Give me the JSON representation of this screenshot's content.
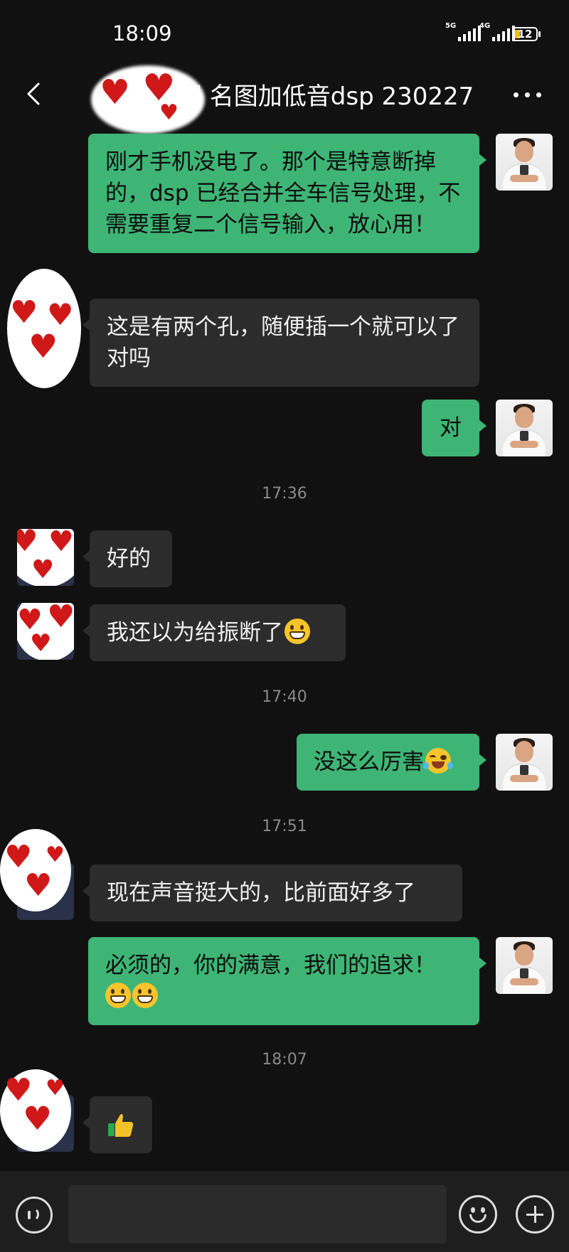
{
  "status_bar": {
    "time": "18:09",
    "signal1_label": "5G",
    "signal2_label": "4G",
    "battery": "12"
  },
  "header": {
    "title": "贸  名图加低音dsp 230227",
    "back_icon": "chevron-left-icon",
    "more_icon": "more-dots-icon"
  },
  "colors": {
    "outgoing_bubble": "#3eb575",
    "incoming_bubble": "#2c2c2c",
    "background": "#111111"
  },
  "messages": [
    {
      "side": "out",
      "text": "刚才手机没电了。那个是特意断掉的，dsp 已经合并全车信号处理，不需要重复二个信号输入，放心用！"
    },
    {
      "side": "in",
      "text": "这是有两个孔，随便插一个就可以了对吗"
    },
    {
      "side": "out",
      "text": "对"
    },
    {
      "side": "time",
      "text": "17:36"
    },
    {
      "side": "in",
      "text": "好的"
    },
    {
      "side": "in",
      "text": "我还以为给振断了",
      "emoji": "grin"
    },
    {
      "side": "time",
      "text": "17:40"
    },
    {
      "side": "out",
      "text": "没这么厉害",
      "emoji": "laugh-cry"
    },
    {
      "side": "time",
      "text": "17:51"
    },
    {
      "side": "in",
      "text": "现在声音挺大的，比前面好多了"
    },
    {
      "side": "out",
      "text": "必须的，你的满意，我们的追求！",
      "emoji": "grin grin"
    },
    {
      "side": "time",
      "text": "18:07"
    },
    {
      "side": "in",
      "text": "",
      "emoji": "thumbs-up"
    }
  ],
  "footer": {
    "voice_icon": "voice-icon",
    "emoji_icon": "emoji-icon",
    "plus_icon": "plus-icon",
    "input_value": ""
  }
}
